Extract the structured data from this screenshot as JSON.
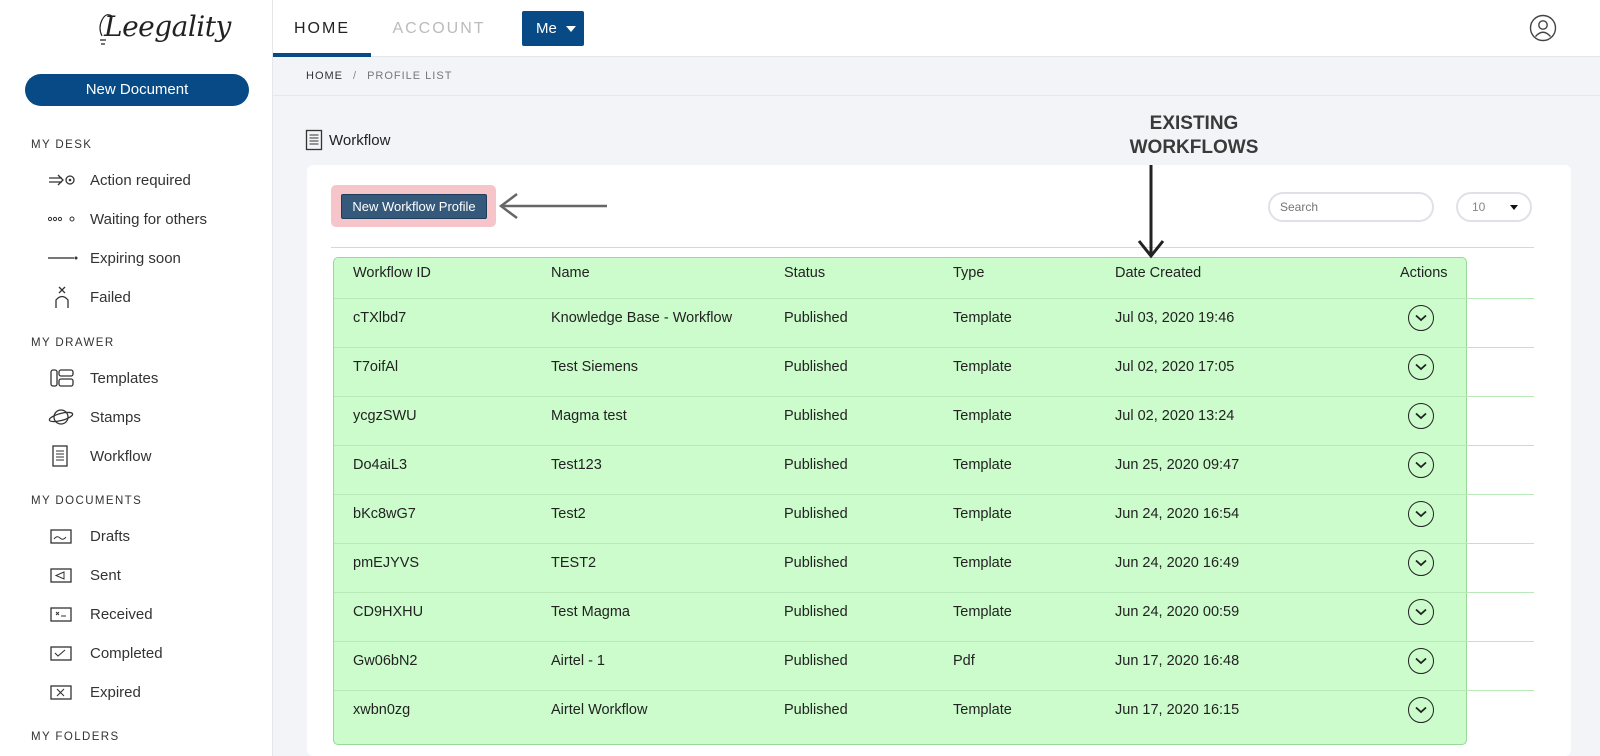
{
  "logo": {
    "text": "Leegality"
  },
  "sidebar": {
    "new_document": "New Document",
    "sections": [
      {
        "title": "MY DESK",
        "items": [
          {
            "label": "Action required",
            "icon": "action-required-icon"
          },
          {
            "label": "Waiting for others",
            "icon": "waiting-dots-icon"
          },
          {
            "label": "Expiring soon",
            "icon": "expiring-line-icon"
          },
          {
            "label": "Failed",
            "icon": "failed-icon"
          }
        ]
      },
      {
        "title": "MY DRAWER",
        "items": [
          {
            "label": "Templates",
            "icon": "templates-icon"
          },
          {
            "label": "Stamps",
            "icon": "stamps-icon"
          },
          {
            "label": "Workflow",
            "icon": "workflow-icon"
          }
        ]
      },
      {
        "title": "MY DOCUMENTS",
        "items": [
          {
            "label": "Drafts",
            "icon": "drafts-icon"
          },
          {
            "label": "Sent",
            "icon": "sent-icon"
          },
          {
            "label": "Received",
            "icon": "received-icon"
          },
          {
            "label": "Completed",
            "icon": "completed-icon"
          },
          {
            "label": "Expired",
            "icon": "expired-icon"
          }
        ]
      },
      {
        "title": "MY FOLDERS",
        "items": []
      }
    ]
  },
  "header": {
    "tabs": [
      {
        "label": "HOME",
        "active": true
      },
      {
        "label": "ACCOUNT",
        "active": false
      }
    ],
    "me_label": "Me",
    "user_icon": "user-circle-icon"
  },
  "breadcrumb": {
    "home": "HOME",
    "separator": "/",
    "current": "PROFILE LIST"
  },
  "page": {
    "title": "Workflow",
    "new_workflow_button": "New Workflow Profile",
    "search_placeholder": "Search",
    "page_size": "10"
  },
  "annotation": {
    "line1": "EXISTING",
    "line2": "WORKFLOWS"
  },
  "table": {
    "columns": [
      "Workflow ID",
      "Name",
      "Status",
      "Type",
      "Date Created",
      "Actions"
    ],
    "rows": [
      {
        "id": "cTXlbd7",
        "name": "Knowledge Base - Workflow",
        "status": "Published",
        "type": "Template",
        "date": "Jul 03, 2020 19:46"
      },
      {
        "id": "T7oifAl",
        "name": "Test Siemens",
        "status": "Published",
        "type": "Template",
        "date": "Jul 02, 2020 17:05"
      },
      {
        "id": "ycgzSWU",
        "name": "Magma test",
        "status": "Published",
        "type": "Template",
        "date": "Jul 02, 2020 13:24"
      },
      {
        "id": "Do4aiL3",
        "name": "Test123",
        "status": "Published",
        "type": "Template",
        "date": "Jun 25, 2020 09:47"
      },
      {
        "id": "bKc8wG7",
        "name": "Test2",
        "status": "Published",
        "type": "Template",
        "date": "Jun 24, 2020 16:54"
      },
      {
        "id": "pmEJYVS",
        "name": "TEST2",
        "status": "Published",
        "type": "Template",
        "date": "Jun 24, 2020 16:49"
      },
      {
        "id": "CD9HXHU",
        "name": "Test Magma",
        "status": "Published",
        "type": "Template",
        "date": "Jun 24, 2020 00:59"
      },
      {
        "id": "Gw06bN2",
        "name": "Airtel - 1",
        "status": "Published",
        "type": "Pdf",
        "date": "Jun 17, 2020 16:48"
      },
      {
        "id": "xwbn0zg",
        "name": "Airtel Workflow",
        "status": "Published",
        "type": "Template",
        "date": "Jun 17, 2020 16:15"
      }
    ]
  },
  "colors": {
    "primary": "#074a85",
    "highlight_green": "#ccfccc",
    "highlight_red": "#f6c5c9",
    "button_dark": "#35597a"
  }
}
